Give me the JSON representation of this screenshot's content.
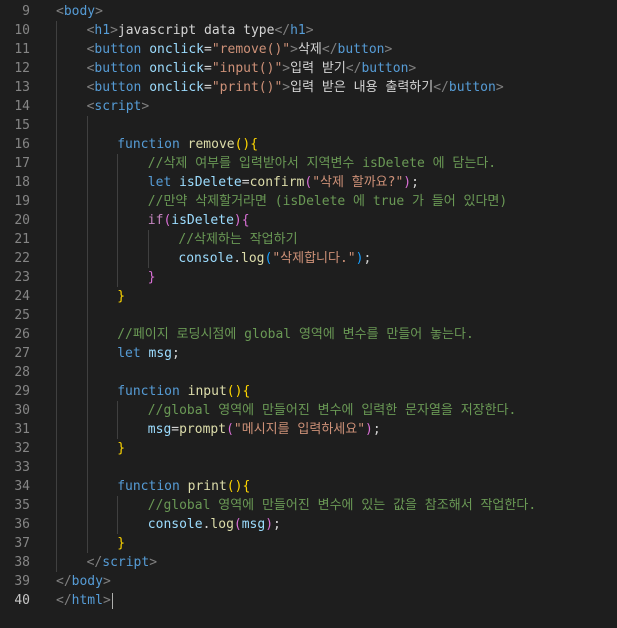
{
  "editor": {
    "active_line": 40,
    "lines": [
      {
        "n": "9",
        "indent": 0,
        "tokens": [
          [
            "t-punct",
            "<"
          ],
          [
            "t-tag",
            "body"
          ],
          [
            "t-punct",
            ">"
          ]
        ]
      },
      {
        "n": "10",
        "indent": 1,
        "tokens": [
          [
            "t-punct",
            "<"
          ],
          [
            "t-tag",
            "h1"
          ],
          [
            "t-punct",
            ">"
          ],
          [
            "t-text",
            "javascript data type"
          ],
          [
            "t-punct",
            "</"
          ],
          [
            "t-tag",
            "h1"
          ],
          [
            "t-punct",
            ">"
          ]
        ]
      },
      {
        "n": "11",
        "indent": 1,
        "tokens": [
          [
            "t-punct",
            "<"
          ],
          [
            "t-tag",
            "button"
          ],
          [
            "t-text",
            " "
          ],
          [
            "t-attr",
            "onclick"
          ],
          [
            "t-text",
            "="
          ],
          [
            "t-str",
            "\"remove()\""
          ],
          [
            "t-punct",
            ">"
          ],
          [
            "t-text",
            "삭제"
          ],
          [
            "t-punct",
            "</"
          ],
          [
            "t-tag",
            "button"
          ],
          [
            "t-punct",
            ">"
          ]
        ]
      },
      {
        "n": "12",
        "indent": 1,
        "tokens": [
          [
            "t-punct",
            "<"
          ],
          [
            "t-tag",
            "button"
          ],
          [
            "t-text",
            " "
          ],
          [
            "t-attr",
            "onclick"
          ],
          [
            "t-text",
            "="
          ],
          [
            "t-str",
            "\"input()\""
          ],
          [
            "t-punct",
            ">"
          ],
          [
            "t-text",
            "입력 받기"
          ],
          [
            "t-punct",
            "</"
          ],
          [
            "t-tag",
            "button"
          ],
          [
            "t-punct",
            ">"
          ]
        ]
      },
      {
        "n": "13",
        "indent": 1,
        "tokens": [
          [
            "t-punct",
            "<"
          ],
          [
            "t-tag",
            "button"
          ],
          [
            "t-text",
            " "
          ],
          [
            "t-attr",
            "onclick"
          ],
          [
            "t-text",
            "="
          ],
          [
            "t-str",
            "\"print()\""
          ],
          [
            "t-punct",
            ">"
          ],
          [
            "t-text",
            "입력 받은 내용 출력하기"
          ],
          [
            "t-punct",
            "</"
          ],
          [
            "t-tag",
            "button"
          ],
          [
            "t-punct",
            ">"
          ]
        ]
      },
      {
        "n": "14",
        "indent": 1,
        "tokens": [
          [
            "t-punct",
            "<"
          ],
          [
            "t-tag",
            "script"
          ],
          [
            "t-punct",
            ">"
          ]
        ]
      },
      {
        "n": "15",
        "indent": 2,
        "tokens": []
      },
      {
        "n": "16",
        "indent": 2,
        "tokens": [
          [
            "t-kw",
            "function"
          ],
          [
            "t-text",
            " "
          ],
          [
            "t-fn",
            "remove"
          ],
          [
            "t-b1",
            "()"
          ],
          [
            "t-b1",
            "{"
          ]
        ]
      },
      {
        "n": "17",
        "indent": 3,
        "tokens": [
          [
            "t-comment",
            "//삭제 여부를 입력받아서 지역변수 isDelete 에 담는다."
          ]
        ]
      },
      {
        "n": "18",
        "indent": 3,
        "tokens": [
          [
            "t-kw",
            "let"
          ],
          [
            "t-text",
            " "
          ],
          [
            "t-var",
            "isDelete"
          ],
          [
            "t-text",
            "="
          ],
          [
            "t-fn",
            "confirm"
          ],
          [
            "t-b2",
            "("
          ],
          [
            "t-str",
            "\"삭제 할까요?\""
          ],
          [
            "t-b2",
            ")"
          ],
          [
            "t-text",
            ";"
          ]
        ]
      },
      {
        "n": "19",
        "indent": 3,
        "tokens": [
          [
            "t-comment",
            "//만약 삭제할거라면 (isDelete 에 true 가 들어 있다면)"
          ]
        ]
      },
      {
        "n": "20",
        "indent": 3,
        "tokens": [
          [
            "t-ctrl",
            "if"
          ],
          [
            "t-b2",
            "("
          ],
          [
            "t-var",
            "isDelete"
          ],
          [
            "t-b2",
            ")"
          ],
          [
            "t-b2",
            "{"
          ]
        ]
      },
      {
        "n": "21",
        "indent": 4,
        "tokens": [
          [
            "t-comment",
            "//삭제하는 작업하기"
          ]
        ]
      },
      {
        "n": "22",
        "indent": 4,
        "tokens": [
          [
            "t-var",
            "console"
          ],
          [
            "t-text",
            "."
          ],
          [
            "t-fn",
            "log"
          ],
          [
            "t-b3",
            "("
          ],
          [
            "t-str",
            "\"삭제합니다.\""
          ],
          [
            "t-b3",
            ")"
          ],
          [
            "t-text",
            ";"
          ]
        ]
      },
      {
        "n": "23",
        "indent": 3,
        "tokens": [
          [
            "t-b2",
            "}"
          ]
        ]
      },
      {
        "n": "24",
        "indent": 2,
        "tokens": [
          [
            "t-b1",
            "}"
          ]
        ]
      },
      {
        "n": "25",
        "indent": 2,
        "tokens": []
      },
      {
        "n": "26",
        "indent": 2,
        "tokens": [
          [
            "t-comment",
            "//페이지 로딩시점에 global 영역에 변수를 만들어 놓는다."
          ]
        ]
      },
      {
        "n": "27",
        "indent": 2,
        "tokens": [
          [
            "t-kw",
            "let"
          ],
          [
            "t-text",
            " "
          ],
          [
            "t-var",
            "msg"
          ],
          [
            "t-text",
            ";"
          ]
        ]
      },
      {
        "n": "28",
        "indent": 2,
        "tokens": []
      },
      {
        "n": "29",
        "indent": 2,
        "tokens": [
          [
            "t-kw",
            "function"
          ],
          [
            "t-text",
            " "
          ],
          [
            "t-fn",
            "input"
          ],
          [
            "t-b1",
            "()"
          ],
          [
            "t-b1",
            "{"
          ]
        ]
      },
      {
        "n": "30",
        "indent": 3,
        "tokens": [
          [
            "t-comment",
            "//global 영역에 만들어진 변수에 입력한 문자열을 저장한다."
          ]
        ]
      },
      {
        "n": "31",
        "indent": 3,
        "tokens": [
          [
            "t-var",
            "msg"
          ],
          [
            "t-text",
            "="
          ],
          [
            "t-fn",
            "prompt"
          ],
          [
            "t-b2",
            "("
          ],
          [
            "t-str",
            "\"메시지를 입력하세요\""
          ],
          [
            "t-b2",
            ")"
          ],
          [
            "t-text",
            ";"
          ]
        ]
      },
      {
        "n": "32",
        "indent": 2,
        "tokens": [
          [
            "t-b1",
            "}"
          ]
        ]
      },
      {
        "n": "33",
        "indent": 2,
        "tokens": []
      },
      {
        "n": "34",
        "indent": 2,
        "tokens": [
          [
            "t-kw",
            "function"
          ],
          [
            "t-text",
            " "
          ],
          [
            "t-fn",
            "print"
          ],
          [
            "t-b1",
            "()"
          ],
          [
            "t-b1",
            "{"
          ]
        ]
      },
      {
        "n": "35",
        "indent": 3,
        "tokens": [
          [
            "t-comment",
            "//global 영역에 만들어진 변수에 있는 값을 참조해서 작업한다."
          ]
        ]
      },
      {
        "n": "36",
        "indent": 3,
        "tokens": [
          [
            "t-var",
            "console"
          ],
          [
            "t-text",
            "."
          ],
          [
            "t-fn",
            "log"
          ],
          [
            "t-b2",
            "("
          ],
          [
            "t-var",
            "msg"
          ],
          [
            "t-b2",
            ")"
          ],
          [
            "t-text",
            ";"
          ]
        ]
      },
      {
        "n": "37",
        "indent": 2,
        "tokens": [
          [
            "t-b1",
            "}"
          ]
        ]
      },
      {
        "n": "38",
        "indent": 1,
        "tokens": [
          [
            "t-punct",
            "</"
          ],
          [
            "t-tag",
            "script"
          ],
          [
            "t-punct",
            ">"
          ]
        ]
      },
      {
        "n": "39",
        "indent": 0,
        "tokens": [
          [
            "t-punct",
            "</"
          ],
          [
            "t-tag",
            "body"
          ],
          [
            "t-punct",
            ">"
          ]
        ]
      },
      {
        "n": "40",
        "indent": 0,
        "tokens": [
          [
            "t-punct",
            "</"
          ],
          [
            "t-tag",
            "html"
          ],
          [
            "t-punct",
            ">"
          ]
        ]
      }
    ]
  }
}
